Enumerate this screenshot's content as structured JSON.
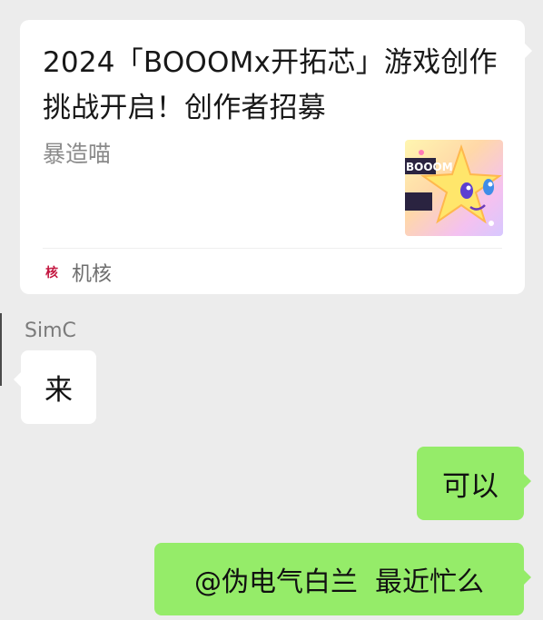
{
  "shared_card": {
    "title": "2024「BOOOMx开拓芯」游戏创作挑战开启！创作者招募",
    "description": "暴造喵",
    "thumbnail_icon": "game-poster-thumbnail",
    "thumbnail_text": "BOOOM",
    "source_logo": "核",
    "source_name": "机核"
  },
  "messages": [
    {
      "sender": "SimC",
      "text": "来",
      "side": "left"
    },
    {
      "text": "可以",
      "side": "right"
    },
    {
      "text": "@伪电气白兰  最近忙么",
      "side": "right"
    }
  ],
  "colors": {
    "background": "#ececec",
    "incoming_bubble": "#ffffff",
    "outgoing_bubble": "#95ec69",
    "source_logo": "#c3163f"
  }
}
